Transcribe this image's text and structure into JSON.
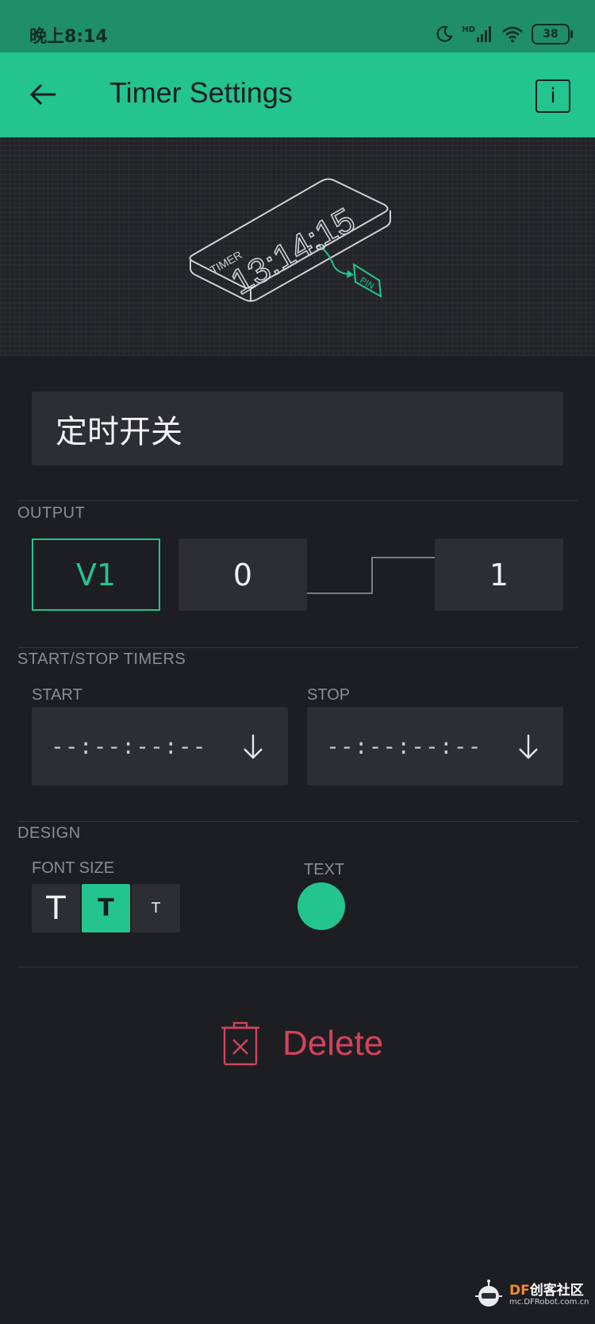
{
  "status_bar": {
    "time": "晚上8:14",
    "signal_label": "HD",
    "battery": "38"
  },
  "app_bar": {
    "title": "Timer Settings",
    "info_label": "i"
  },
  "preview": {
    "widget_label": "TIMER",
    "widget_time": "13:14:15",
    "pin_label": "PIN"
  },
  "name_field": {
    "value": "定时开关"
  },
  "output": {
    "section_label": "OUTPUT",
    "pin": "V1",
    "low_value": "0",
    "high_value": "1"
  },
  "timers": {
    "section_label": "START/STOP TIMERS",
    "start_label": "START",
    "start_value": "--:--:--:--",
    "stop_label": "STOP",
    "stop_value": "--:--:--:--"
  },
  "design": {
    "section_label": "DESIGN",
    "font_size_label": "FONT SIZE",
    "font_size_options": [
      "T",
      "T",
      "T"
    ],
    "selected_font_size_index": 1,
    "text_label": "TEXT",
    "text_color": "#23c48e"
  },
  "actions": {
    "delete_label": "Delete"
  },
  "watermark": {
    "brand": "DF",
    "name": "创客社区",
    "url": "mc.DFRobot.com.cn"
  },
  "colors": {
    "accent": "#23c48e",
    "danger": "#d3435c",
    "background": "#1d1e22"
  }
}
